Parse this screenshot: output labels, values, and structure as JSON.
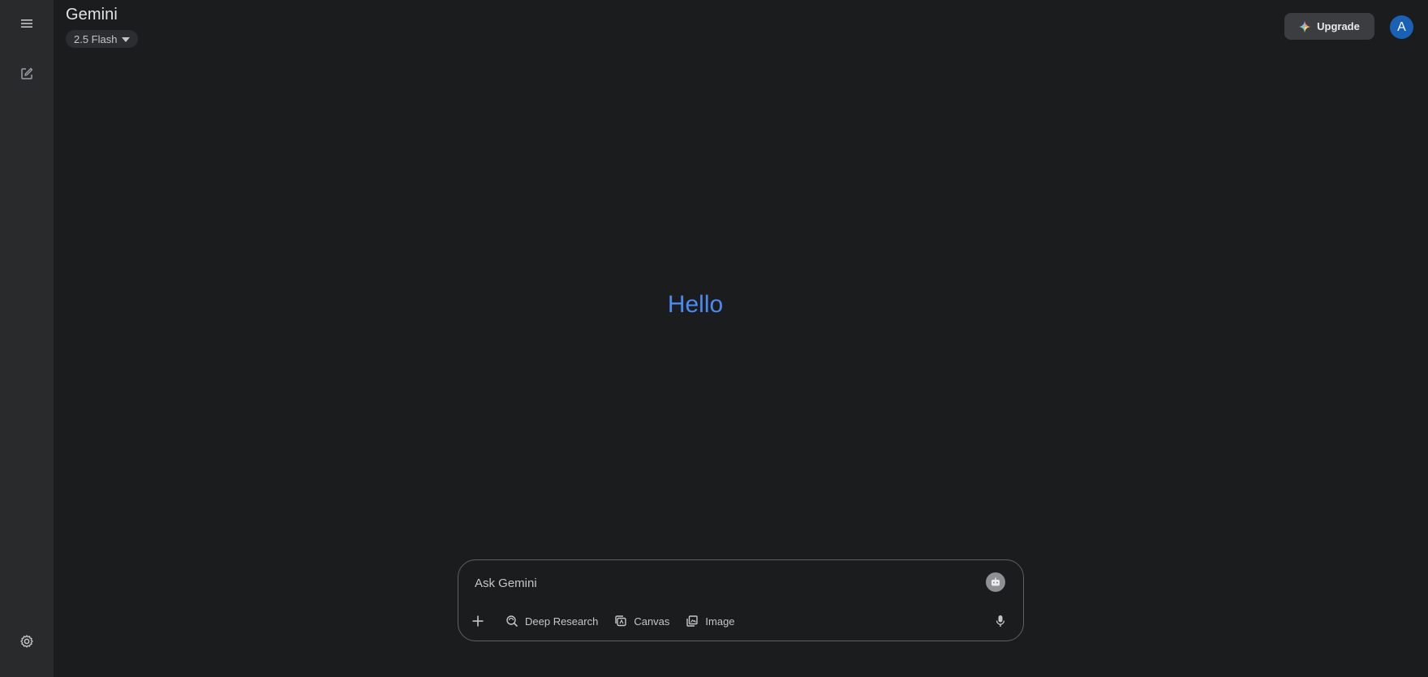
{
  "app": {
    "title": "Gemini",
    "model_label": "2.5 Flash"
  },
  "rail": {
    "menu_icon": "hamburger-menu-icon",
    "new_chat_icon": "edit-square-icon",
    "settings_icon": "gear-icon"
  },
  "header": {
    "upgrade_label": "Upgrade",
    "upgrade_icon": "sparkle-icon",
    "avatar_initial": "A"
  },
  "main": {
    "greeting": "Hello"
  },
  "composer": {
    "placeholder": "Ask Gemini",
    "tools": [
      {
        "label": "Deep Research",
        "icon": "deep-research-icon"
      },
      {
        "label": "Canvas",
        "icon": "canvas-icon"
      },
      {
        "label": "Image",
        "icon": "image-stack-icon"
      }
    ],
    "add_icon": "plus-icon",
    "mic_icon": "microphone-icon"
  },
  "colors": {
    "background": "#1b1c1d",
    "rail": "#282a2c",
    "greeting": "#4b8af1",
    "avatar": "#1a61b5",
    "upgrade_button": "#3c3d40"
  }
}
